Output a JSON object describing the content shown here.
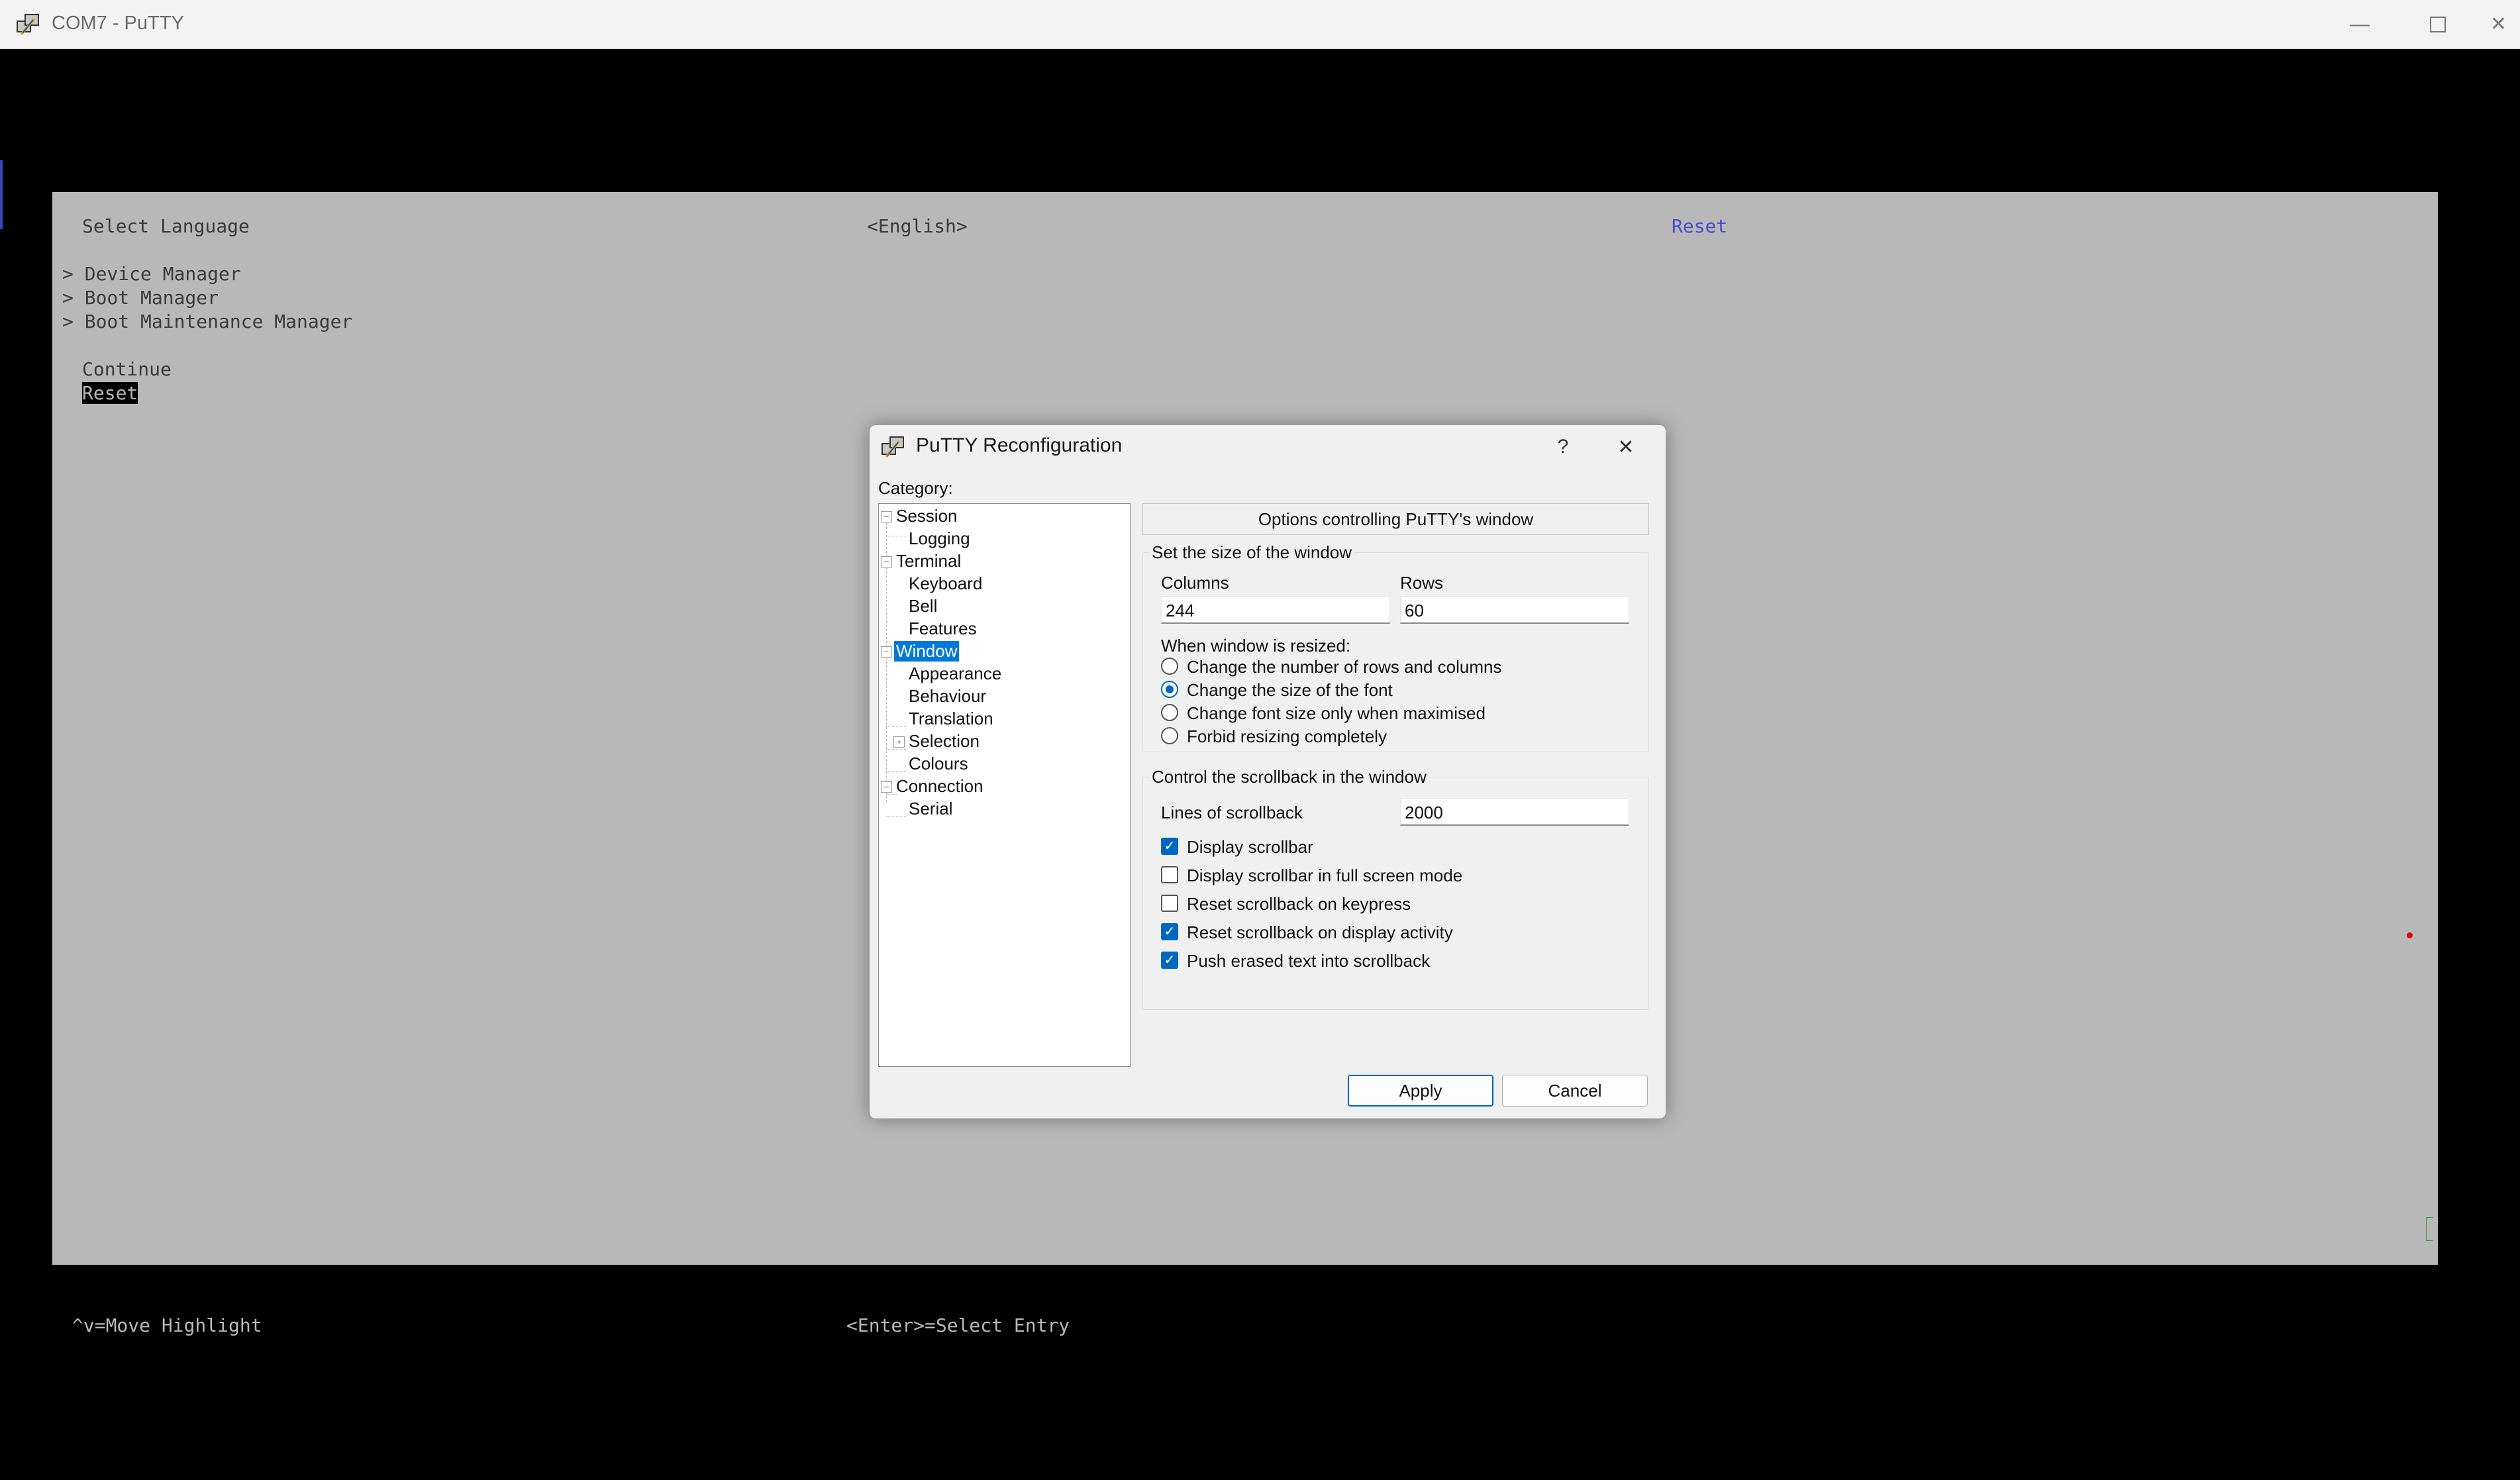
{
  "window": {
    "title": "COM7 - PuTTY",
    "minimize_icon": "minimize-icon",
    "maximize_icon": "maximize-icon",
    "close_icon": "close-icon"
  },
  "bios": {
    "language_label": "Select Language",
    "language_value": "<English>",
    "help_text": "Reset",
    "menu": [
      "> Device Manager",
      "> Boot Manager",
      "> Boot Maintenance Manager"
    ],
    "continue_label": "Continue",
    "reset_label": "Reset",
    "footer_left": "^v=Move Highlight",
    "footer_center": "<Enter>=Select Entry"
  },
  "dialog": {
    "title": "PuTTY Reconfiguration",
    "help_symbol": "?",
    "close_symbol": "✕",
    "category_label": "Category:",
    "tree": {
      "session": "Session",
      "logging": "Logging",
      "terminal": "Terminal",
      "keyboard": "Keyboard",
      "bell": "Bell",
      "features": "Features",
      "window": "Window",
      "appearance": "Appearance",
      "behaviour": "Behaviour",
      "translation": "Translation",
      "selection": "Selection",
      "colours": "Colours",
      "connection": "Connection",
      "serial": "Serial"
    },
    "panel_title": "Options controlling PuTTY's window",
    "size_group": {
      "title": "Set the size of the window",
      "columns_label": "Columns",
      "columns_value": "244",
      "rows_label": "Rows",
      "rows_value": "60",
      "resize_label": "When window is resized:",
      "options": [
        {
          "label": "Change the number of rows and columns",
          "selected": false
        },
        {
          "label": "Change the size of the font",
          "selected": true
        },
        {
          "label": "Change font size only when maximised",
          "selected": false
        },
        {
          "label": "Forbid resizing completely",
          "selected": false
        }
      ]
    },
    "scroll_group": {
      "title": "Control the scrollback in the window",
      "lines_label": "Lines of scrollback",
      "lines_value": "2000",
      "checks": [
        {
          "label": "Display scrollbar",
          "checked": true
        },
        {
          "label": "Display scrollbar in full screen mode",
          "checked": false
        },
        {
          "label": "Reset scrollback on keypress",
          "checked": false
        },
        {
          "label": "Reset scrollback on display activity",
          "checked": true
        },
        {
          "label": "Push erased text into scrollback",
          "checked": true
        }
      ]
    },
    "apply_label": "Apply",
    "cancel_label": "Cancel"
  },
  "colors": {
    "bios_bg": "#b8b8b8",
    "accent": "#0067c0",
    "help_text": "#4a4ad0"
  }
}
